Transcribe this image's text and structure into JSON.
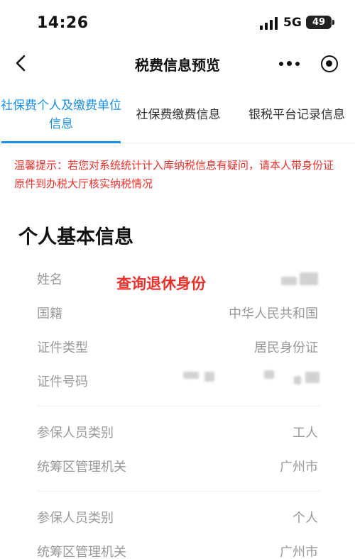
{
  "status_bar": {
    "time": "14:26",
    "network": "5G",
    "battery": "49"
  },
  "nav": {
    "title": "税费信息预览"
  },
  "tabs": [
    {
      "label": "社保费个人及缴费单位信息",
      "active": true
    },
    {
      "label": "社保费缴费信息",
      "active": false
    },
    {
      "label": "银税平台记录信息",
      "active": false
    }
  ],
  "notice": "温馨提示：若您对系统统计计入库纳税信息有疑问，请本人带身份证原件到办税大厅核实纳税情况",
  "section_title": "个人基本信息",
  "overlay_text": "查询退休身份",
  "rows": [
    {
      "label": "姓名",
      "value": ""
    },
    {
      "label": "国籍",
      "value": "中华人民共和国"
    },
    {
      "label": "证件类型",
      "value": "居民身份证"
    },
    {
      "label": "证件号码",
      "value": ""
    },
    {
      "label": "参保人员类别",
      "value": "工人"
    },
    {
      "label": "统筹区管理机关",
      "value": "广州市"
    },
    {
      "label": "参保人员类别",
      "value": "个人"
    },
    {
      "label": "统筹区管理机关",
      "value": "广州市"
    }
  ],
  "colors": {
    "accent": "#1a8fe3",
    "warning": "#e8312a",
    "muted": "#999999"
  }
}
